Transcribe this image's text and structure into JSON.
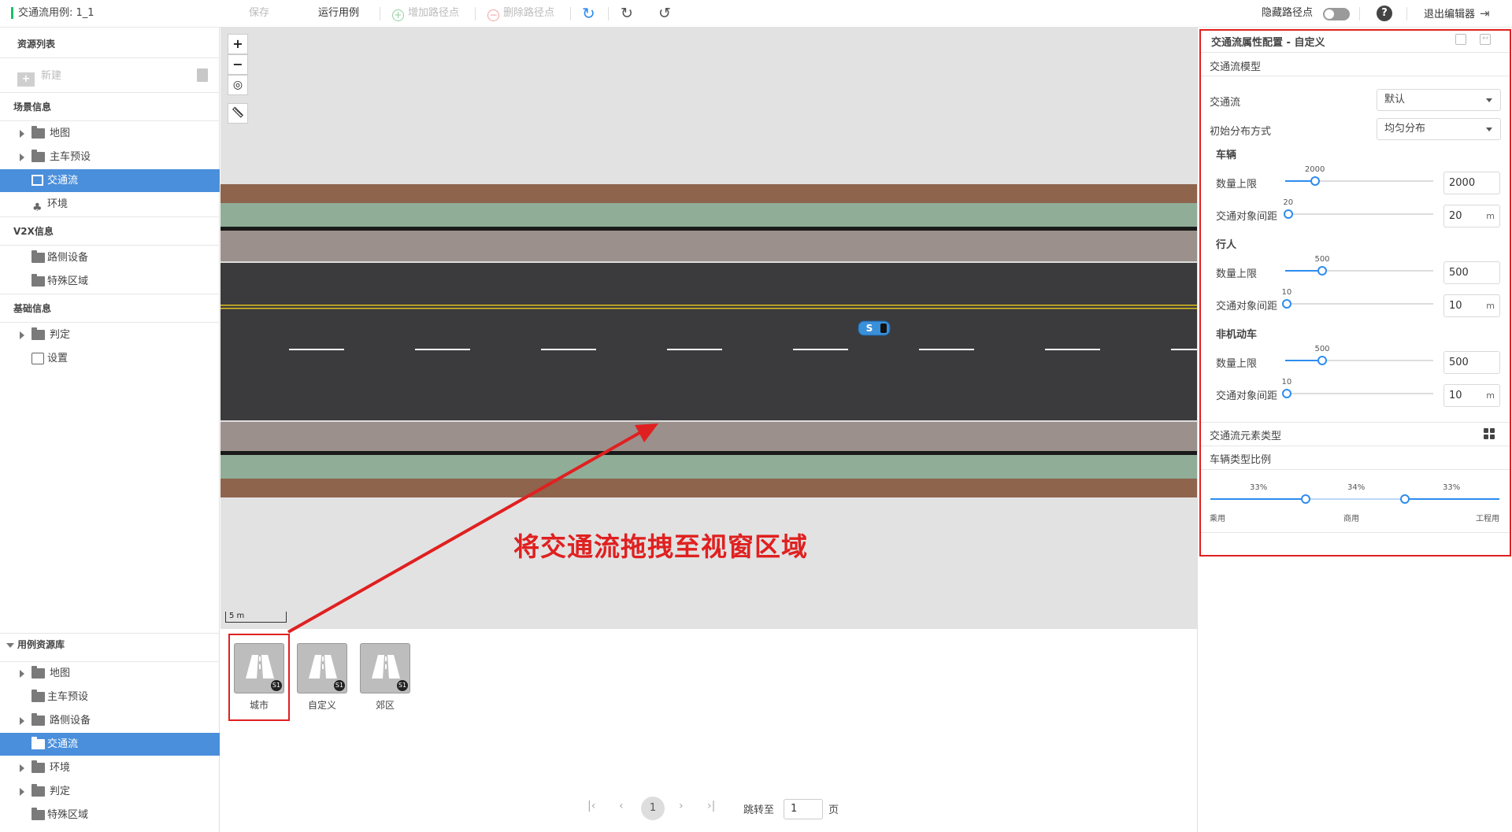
{
  "app": {
    "case_title": "交通流用例: 1_1"
  },
  "toolbar": {
    "save": "保存",
    "run_case": "运行用例",
    "add_waypoint": "增加路径点",
    "delete_waypoint": "删除路径点",
    "hide_waypoint": "隐藏路径点",
    "exit_editor": "退出编辑器",
    "help": "?"
  },
  "sidebar": {
    "resource_list": "资源列表",
    "new": "新建",
    "scene_info": "场景信息",
    "scene_items": [
      "地图",
      "主车预设",
      "交通流",
      "环境"
    ],
    "v2x_info": "V2X信息",
    "v2x_items": [
      "路侧设备",
      "特殊区域"
    ],
    "basic_info": "基础信息",
    "basic_items": [
      "判定",
      "设置"
    ],
    "case_library": "用例资源库",
    "library_items": [
      "地图",
      "主车预设",
      "路侧设备",
      "交通流",
      "环境",
      "判定",
      "特殊区域"
    ]
  },
  "viewport": {
    "scale": "5 m",
    "ego_label": "S"
  },
  "library": {
    "cards": [
      {
        "label": "城市",
        "badge": "S1"
      },
      {
        "label": "自定义",
        "badge": "S1"
      },
      {
        "label": "郊区",
        "badge": "S1"
      }
    ],
    "pagination": {
      "page": "1",
      "jump_label": "跳转至",
      "jump_value": "1",
      "page_unit": "页"
    }
  },
  "annotation": {
    "text": "将交通流拖拽至视窗区域",
    "color": "#e02020"
  },
  "panel": {
    "title": "交通流属性配置 - 自定义",
    "model_section": "交通流模型",
    "traffic_flow_label": "交通流",
    "traffic_flow_value": "默认",
    "distribution_label": "初始分布方式",
    "distribution_value": "均匀分布",
    "groups": [
      {
        "name": "车辆",
        "count_label": "数量上限",
        "count": 2000,
        "count_max": 10000,
        "gap_label": "交通对象间距",
        "gap": 20,
        "gap_max": 1000,
        "unit": "m"
      },
      {
        "name": "行人",
        "count_label": "数量上限",
        "count": 500,
        "count_max": 2000,
        "gap_label": "交通对象间距",
        "gap": 10,
        "gap_max": 1000,
        "unit": "m"
      },
      {
        "name": "非机动车",
        "count_label": "数量上限",
        "count": 500,
        "count_max": 2000,
        "gap_label": "交通对象间距",
        "gap": 10,
        "gap_max": 1000,
        "unit": "m"
      }
    ],
    "element_type_section": "交通流元素类型",
    "vehicle_ratio_section": "车辆类型比例",
    "ratios": [
      {
        "name": "乘用",
        "percent": "33%"
      },
      {
        "name": "商用",
        "percent": "34%"
      },
      {
        "name": "工程用",
        "percent": "33%"
      }
    ]
  },
  "colors": {
    "accent": "#2d8cf0",
    "selected": "#4a8fdb",
    "annotation": "#e02020"
  }
}
